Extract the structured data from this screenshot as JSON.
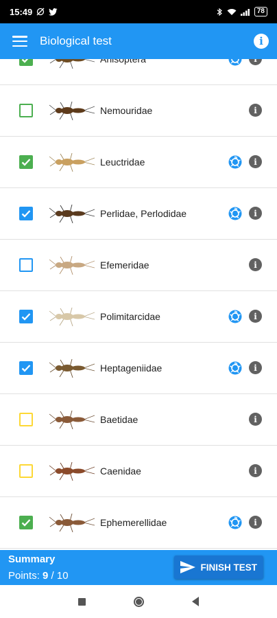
{
  "status_bar": {
    "time": "15:49",
    "battery": "78"
  },
  "app_bar": {
    "title": "Biological test"
  },
  "colors": {
    "primary": "#2196f3",
    "green": "#4caf50",
    "yellow": "#fdd835",
    "grey": "#616161"
  },
  "items": [
    {
      "name": "Anisoptera",
      "checked": true,
      "color": "#4caf50",
      "has_photo": true
    },
    {
      "name": "Nemouridae",
      "checked": false,
      "color": "#4caf50",
      "has_photo": false
    },
    {
      "name": "Leuctridae",
      "checked": true,
      "color": "#4caf50",
      "has_photo": true
    },
    {
      "name": "Perlidae, Perlodidae",
      "checked": true,
      "color": "#2196f3",
      "has_photo": true
    },
    {
      "name": "Efemeridae",
      "checked": false,
      "color": "#2196f3",
      "has_photo": false
    },
    {
      "name": "Polimitarcidae",
      "checked": true,
      "color": "#2196f3",
      "has_photo": true
    },
    {
      "name": "Heptageniidae",
      "checked": true,
      "color": "#2196f3",
      "has_photo": true
    },
    {
      "name": "Baetidae",
      "checked": false,
      "color": "#fdd835",
      "has_photo": false
    },
    {
      "name": "Caenidae",
      "checked": false,
      "color": "#fdd835",
      "has_photo": false
    },
    {
      "name": "Ephemerellidae",
      "checked": true,
      "color": "#4caf50",
      "has_photo": true
    }
  ],
  "summary": {
    "title": "Summary",
    "points_label": "Points: ",
    "points_value": "9",
    "points_sep": " / ",
    "points_total": "10"
  },
  "finish_label": "FINISH TEST"
}
